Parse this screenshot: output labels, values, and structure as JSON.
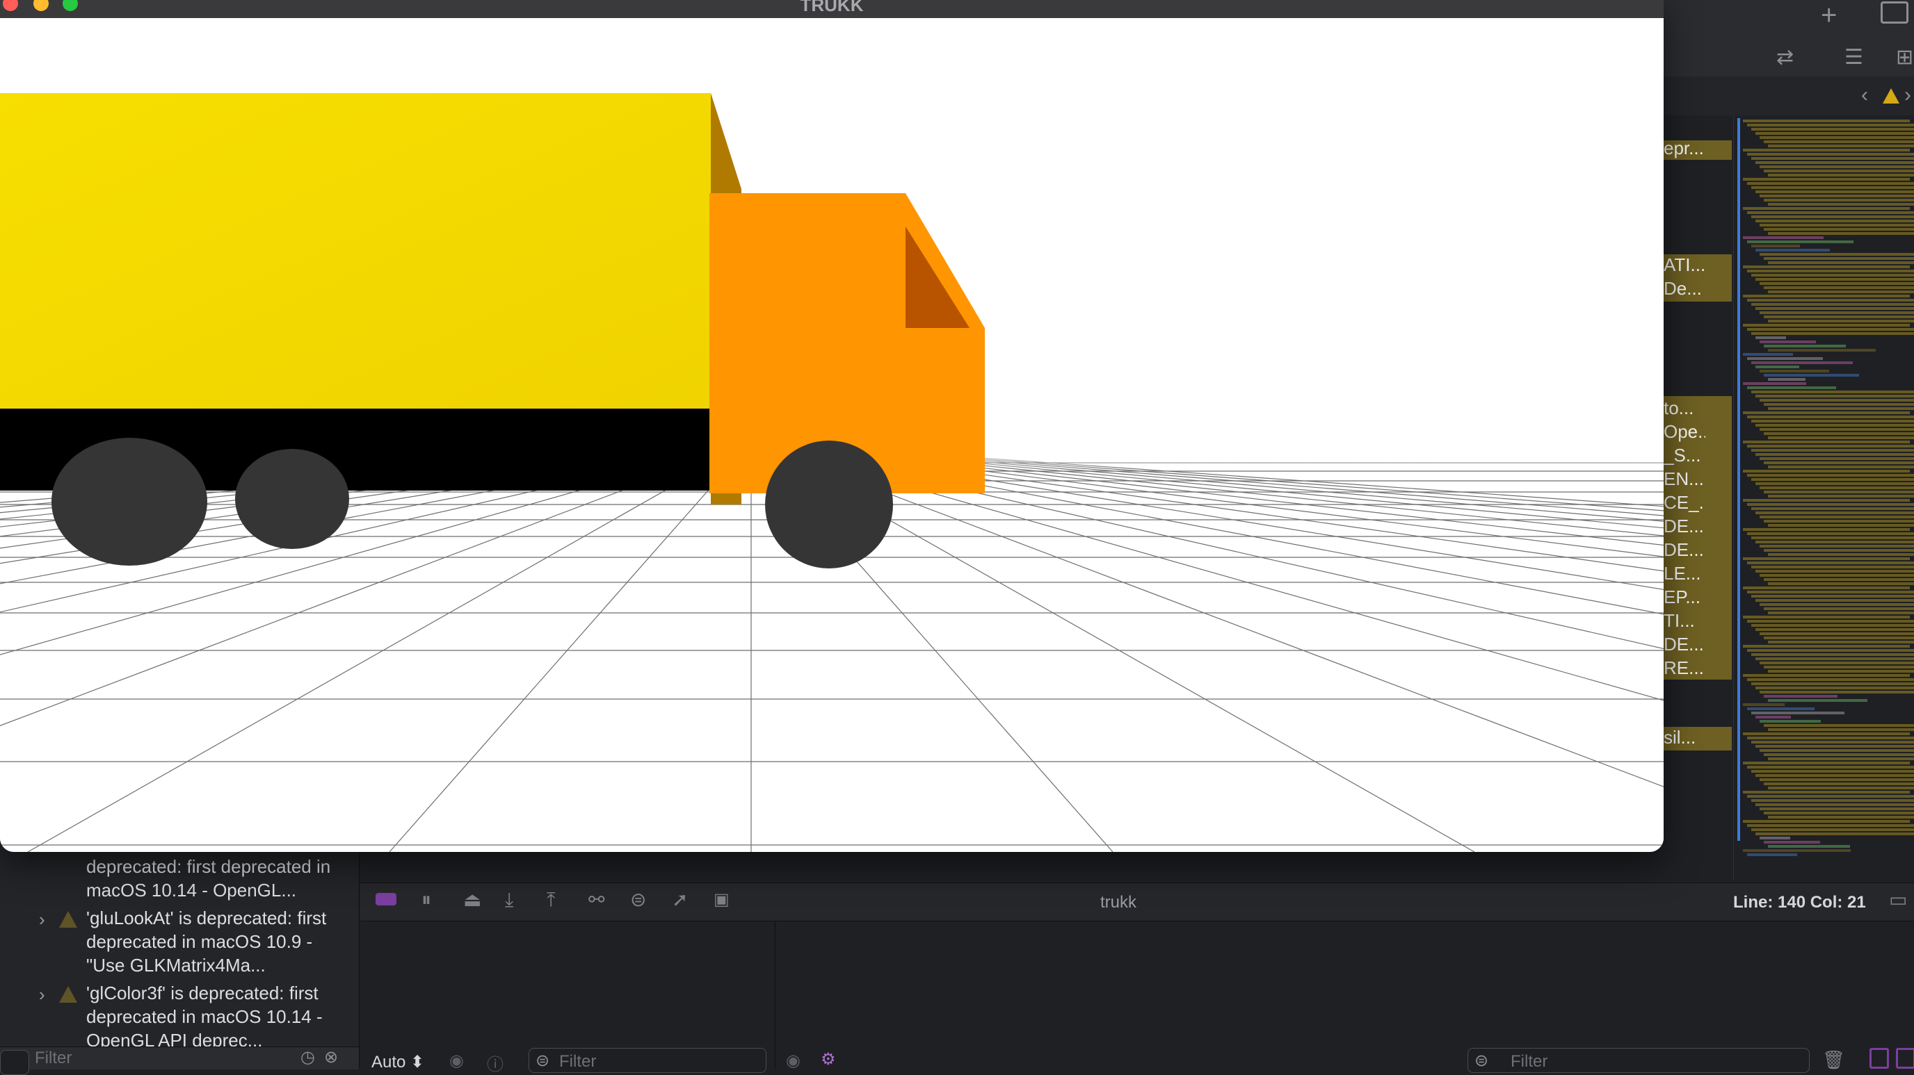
{
  "window": {
    "title": "TRUKK"
  },
  "issues": [
    {
      "text": "deprecated: first deprecated in macOS 10.14 - OpenGL..."
    },
    {
      "text": "'gluLookAt' is deprecated: first deprecated in macOS 10.9 - \"Use GLKMatrix4Ma..."
    },
    {
      "text": "'glColor3f' is deprecated: first deprecated in macOS 10.14 - OpenGL API deprec..."
    }
  ],
  "issue_nav": {
    "filter_placeholder": "Filter"
  },
  "debug_bar": {
    "target": "trukk",
    "line_col": "Line: 140  Col: 21"
  },
  "variables": {
    "scope": "Auto ⬍",
    "filter_placeholder": "Filter"
  },
  "console": {
    "filter_placeholder": "Filter"
  },
  "editor_fragments": [
    "epr...",
    "ATI...",
    "De...",
    "to...",
    "Ope...",
    "_S...",
    "EN...",
    "CE_...",
    "DE...",
    "DE...",
    "LE...",
    "EP...",
    "TI...",
    "DE...",
    "RE...",
    "sil..."
  ],
  "colors": {
    "cargo": "#f5d800",
    "cab": "#ff9500",
    "wheel": "#353535",
    "warning_band": "#6e6022",
    "accent_blue": "#3f7bd8"
  },
  "icons": {
    "add": "+",
    "warning": "warning-triangle",
    "chevron": "›"
  }
}
